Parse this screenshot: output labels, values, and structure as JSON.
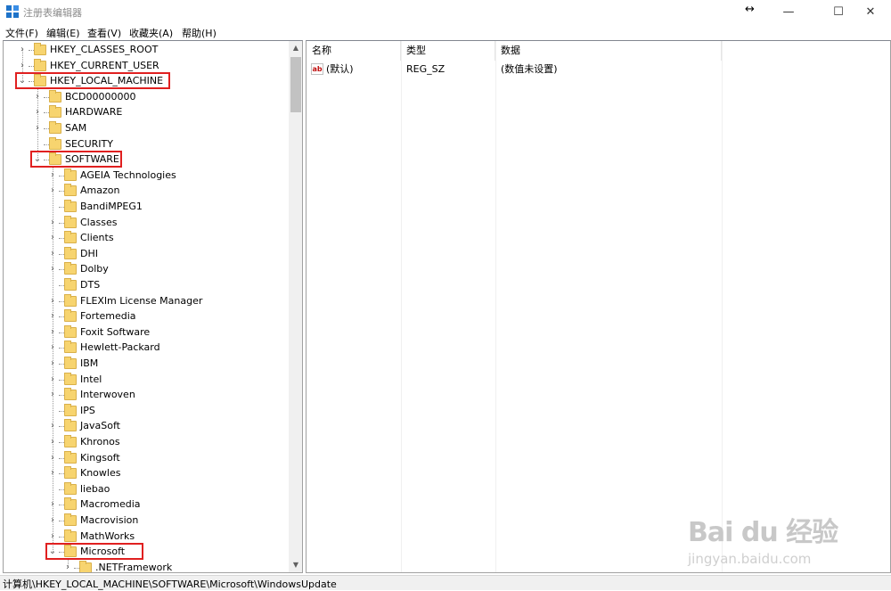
{
  "window": {
    "title": "注册表编辑器",
    "minimize_glyph": "—",
    "maximize_glyph": "☐",
    "close_glyph": "✕",
    "cursor_glyph": "↔"
  },
  "menu": [
    "文件(F)",
    "编辑(E)",
    "查看(V)",
    "收藏夹(A)",
    "帮助(H)"
  ],
  "tree": [
    {
      "label": "HKEY_CLASSES_ROOT",
      "level": 0,
      "expander": "›",
      "highlighted": false
    },
    {
      "label": "HKEY_CURRENT_USER",
      "level": 0,
      "expander": "›",
      "highlighted": false
    },
    {
      "label": "HKEY_LOCAL_MACHINE",
      "level": 0,
      "expander": "⌄",
      "highlighted": true
    },
    {
      "label": "BCD00000000",
      "level": 1,
      "expander": "›",
      "highlighted": false
    },
    {
      "label": "HARDWARE",
      "level": 1,
      "expander": "›",
      "highlighted": false
    },
    {
      "label": "SAM",
      "level": 1,
      "expander": "›",
      "highlighted": false
    },
    {
      "label": "SECURITY",
      "level": 1,
      "expander": "",
      "highlighted": false
    },
    {
      "label": "SOFTWARE",
      "level": 1,
      "expander": "⌄",
      "highlighted": true
    },
    {
      "label": "AGEIA Technologies",
      "level": 2,
      "expander": "›",
      "highlighted": false
    },
    {
      "label": "Amazon",
      "level": 2,
      "expander": "›",
      "highlighted": false
    },
    {
      "label": "BandiMPEG1",
      "level": 2,
      "expander": "",
      "highlighted": false
    },
    {
      "label": "Classes",
      "level": 2,
      "expander": "›",
      "highlighted": false
    },
    {
      "label": "Clients",
      "level": 2,
      "expander": "›",
      "highlighted": false
    },
    {
      "label": "DHI",
      "level": 2,
      "expander": "›",
      "highlighted": false
    },
    {
      "label": "Dolby",
      "level": 2,
      "expander": "›",
      "highlighted": false
    },
    {
      "label": "DTS",
      "level": 2,
      "expander": "",
      "highlighted": false
    },
    {
      "label": "FLEXlm License Manager",
      "level": 2,
      "expander": "›",
      "highlighted": false
    },
    {
      "label": "Fortemedia",
      "level": 2,
      "expander": "›",
      "highlighted": false
    },
    {
      "label": "Foxit Software",
      "level": 2,
      "expander": "›",
      "highlighted": false
    },
    {
      "label": "Hewlett-Packard",
      "level": 2,
      "expander": "›",
      "highlighted": false
    },
    {
      "label": "IBM",
      "level": 2,
      "expander": "›",
      "highlighted": false
    },
    {
      "label": "Intel",
      "level": 2,
      "expander": "›",
      "highlighted": false
    },
    {
      "label": "Interwoven",
      "level": 2,
      "expander": "›",
      "highlighted": false
    },
    {
      "label": "IPS",
      "level": 2,
      "expander": "",
      "highlighted": false
    },
    {
      "label": "JavaSoft",
      "level": 2,
      "expander": "›",
      "highlighted": false
    },
    {
      "label": "Khronos",
      "level": 2,
      "expander": "›",
      "highlighted": false
    },
    {
      "label": "Kingsoft",
      "level": 2,
      "expander": "›",
      "highlighted": false
    },
    {
      "label": "Knowles",
      "level": 2,
      "expander": "›",
      "highlighted": false
    },
    {
      "label": "liebao",
      "level": 2,
      "expander": "",
      "highlighted": false
    },
    {
      "label": "Macromedia",
      "level": 2,
      "expander": "›",
      "highlighted": false
    },
    {
      "label": "Macrovision",
      "level": 2,
      "expander": "›",
      "highlighted": false
    },
    {
      "label": "MathWorks",
      "level": 2,
      "expander": "›",
      "highlighted": false
    },
    {
      "label": "Microsoft",
      "level": 2,
      "expander": "⌄",
      "highlighted": true
    },
    {
      "label": ".NETFramework",
      "level": 3,
      "expander": "›",
      "highlighted": false
    }
  ],
  "values": {
    "columns": [
      "名称",
      "类型",
      "数据"
    ],
    "rows": [
      {
        "name": "(默认)",
        "type": "REG_SZ",
        "data": "(数值未设置)",
        "icon": "ab"
      }
    ]
  },
  "status_path": "计算机\\HKEY_LOCAL_MACHINE\\SOFTWARE\\Microsoft\\WindowsUpdate",
  "watermark": {
    "main": "Bai du 经验",
    "sub": "jingyan.baidu.com"
  },
  "colors": {
    "highlight": "#e02020",
    "folder": "#f7d46f"
  }
}
